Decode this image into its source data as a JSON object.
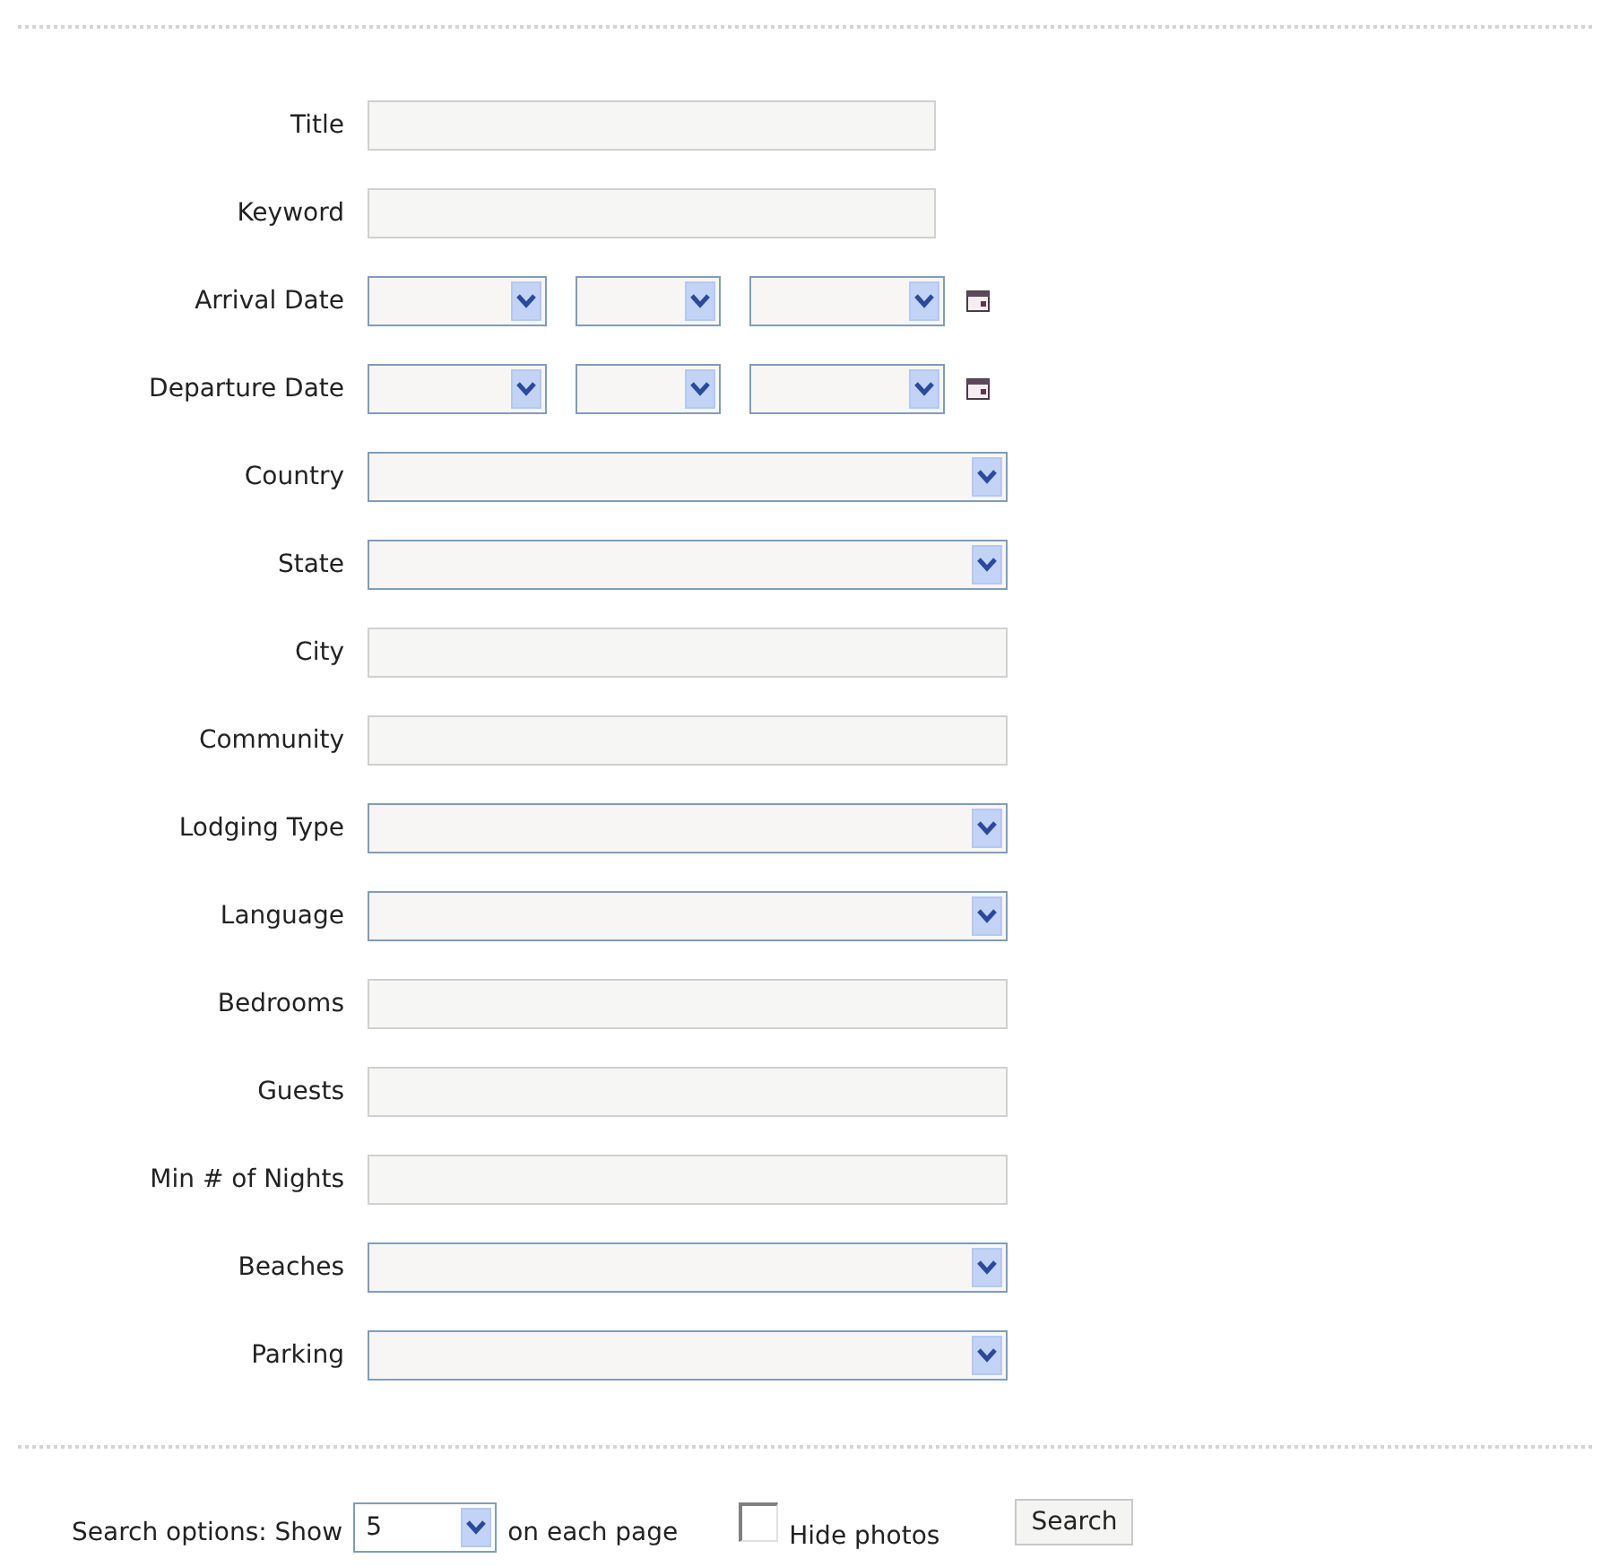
{
  "fields": [
    {
      "label": "Title",
      "kind": "short_text"
    },
    {
      "label": "Keyword",
      "kind": "short_text"
    },
    {
      "label": "Arrival Date",
      "kind": "date"
    },
    {
      "label": "Departure Date",
      "kind": "date"
    },
    {
      "label": "Country",
      "kind": "select"
    },
    {
      "label": "State",
      "kind": "select"
    },
    {
      "label": "City",
      "kind": "text"
    },
    {
      "label": "Community",
      "kind": "text"
    },
    {
      "label": "Lodging Type",
      "kind": "select"
    },
    {
      "label": "Language",
      "kind": "select"
    },
    {
      "label": "Bedrooms",
      "kind": "text"
    },
    {
      "label": "Guests",
      "kind": "text"
    },
    {
      "label": "Min # of Nights",
      "kind": "text"
    },
    {
      "label": "Beaches",
      "kind": "select"
    },
    {
      "label": "Parking",
      "kind": "select"
    }
  ],
  "options": {
    "label": "Search options: Show",
    "per_page": "5",
    "suffix": "on each page",
    "hide_photos": {
      "label": "Hide photos",
      "checked": false
    },
    "button": "Search"
  }
}
